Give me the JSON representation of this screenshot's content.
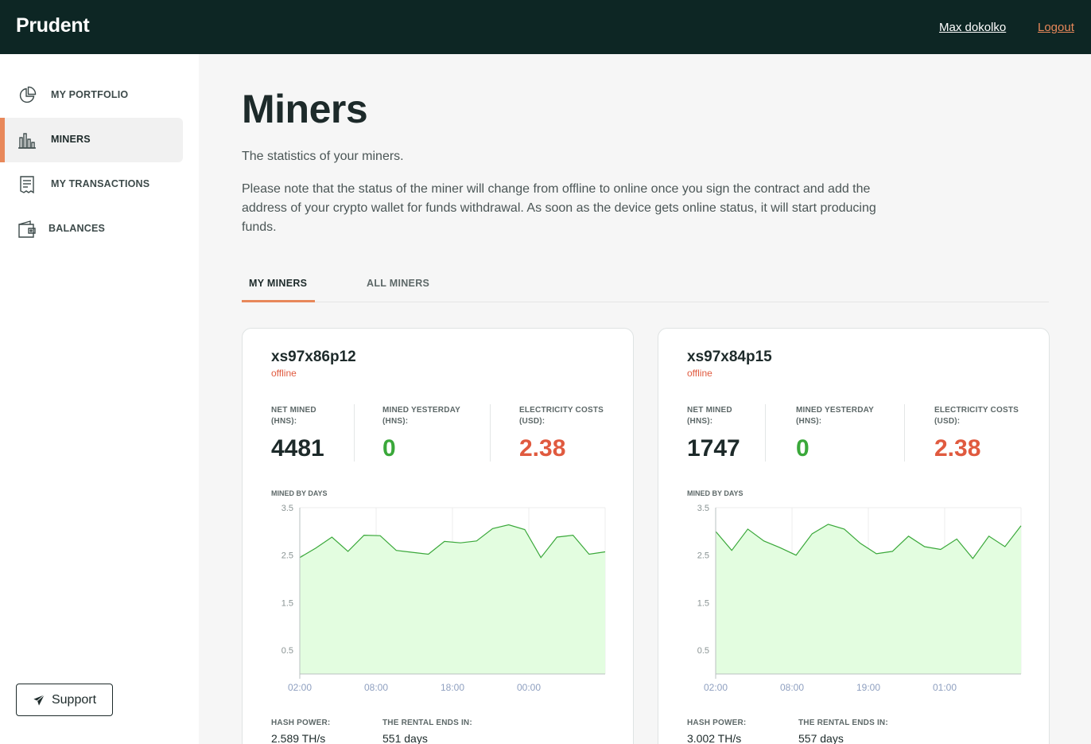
{
  "header": {
    "brand": "Prudent",
    "user_name": "Max dokolko",
    "logout_label": "Logout"
  },
  "sidebar": {
    "items": [
      {
        "label": "MY PORTFOLIO",
        "icon": "pie-chart-icon"
      },
      {
        "label": "MINERS",
        "icon": "bar-chart-icon",
        "active": true
      },
      {
        "label": "MY TRANSACTIONS",
        "icon": "receipt-icon"
      },
      {
        "label": "BALANCES",
        "icon": "wallet-icon"
      }
    ],
    "support_label": "Support",
    "support_icon": "send-icon"
  },
  "page": {
    "title": "Miners",
    "subtitle": "The statistics of your miners.",
    "note": "Please note that the status of the miner will change from offline to online once you sign the contract and add the address of your crypto wallet for funds withdrawal. As soon as the device gets online status, it will start producing funds."
  },
  "tabs": [
    {
      "label": "MY MINERS",
      "active": true
    },
    {
      "label": "ALL MINERS",
      "active": false
    }
  ],
  "colors": {
    "accent": "#e8885a",
    "header_bg": "#0d2624",
    "offline": "#e05a3f",
    "positive": "#3aa83a",
    "chart_line": "#3aa83a",
    "chart_fill": "#e3fde0"
  },
  "miners": [
    {
      "name": "xs97x86p12",
      "status": "offline",
      "net_mined_label": "NET MINED (HNS):",
      "net_mined": "4481",
      "mined_yesterday_label": "MINED YESTERDAY (HNS):",
      "mined_yesterday": "0",
      "electricity_label": "ELECTRICITY COSTS (USD):",
      "electricity": "2.38",
      "chart_title": "MINED BY DAYS",
      "hash_power_label": "HASH POWER:",
      "hash_power": "2.589 TH/s",
      "rental_label": "THE RENTAL ENDS IN:",
      "rental": "551 days"
    },
    {
      "name": "xs97x84p15",
      "status": "offline",
      "net_mined_label": "NET MINED (HNS):",
      "net_mined": "1747",
      "mined_yesterday_label": "MINED YESTERDAY (HNS):",
      "mined_yesterday": "0",
      "electricity_label": "ELECTRICITY COSTS (USD):",
      "electricity": "2.38",
      "chart_title": "MINED BY DAYS",
      "hash_power_label": "HASH POWER:",
      "hash_power": "3.002 TH/s",
      "rental_label": "THE RENTAL ENDS IN:",
      "rental": "557 days"
    }
  ],
  "chart_data": [
    {
      "type": "area",
      "title": "MINED BY DAYS",
      "x_ticks": [
        "02:00",
        "08:00",
        "18:00",
        "00:00"
      ],
      "y_ticks": [
        3.5,
        2.5,
        1.5,
        0.5
      ],
      "ylim": [
        0,
        3.5
      ],
      "grid": true,
      "values": [
        2.45,
        2.65,
        2.88,
        2.58,
        2.92,
        2.91,
        2.6,
        2.56,
        2.52,
        2.79,
        2.76,
        2.8,
        3.06,
        3.14,
        3.04,
        2.45,
        2.88,
        2.92,
        2.52,
        2.57
      ]
    },
    {
      "type": "area",
      "title": "MINED BY DAYS",
      "x_ticks": [
        "02:00",
        "08:00",
        "19:00",
        "01:00"
      ],
      "y_ticks": [
        3.5,
        2.5,
        1.5,
        0.5
      ],
      "ylim": [
        0,
        3.5
      ],
      "grid": true,
      "values": [
        3.0,
        2.6,
        3.05,
        2.8,
        2.66,
        2.5,
        2.95,
        3.15,
        3.05,
        2.75,
        2.53,
        2.58,
        2.9,
        2.68,
        2.62,
        2.84,
        2.43,
        2.9,
        2.68,
        3.12
      ]
    }
  ]
}
